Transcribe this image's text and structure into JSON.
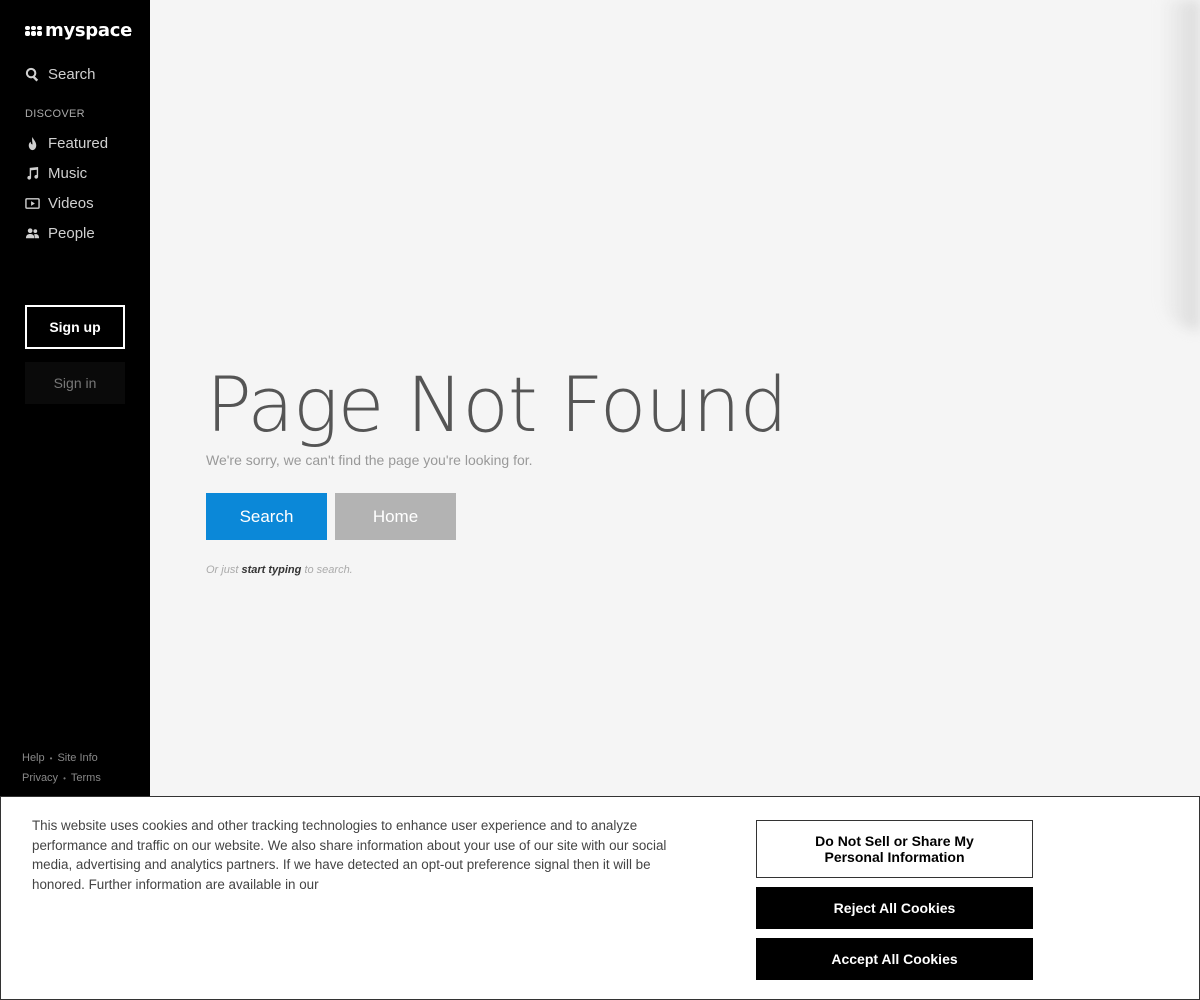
{
  "logo": {
    "text": "myspace"
  },
  "sidebar": {
    "search_label": "Search",
    "section_label": "DISCOVER",
    "items": [
      {
        "label": "Featured",
        "icon": "flame-icon"
      },
      {
        "label": "Music",
        "icon": "music-note-icon"
      },
      {
        "label": "Videos",
        "icon": "video-icon"
      },
      {
        "label": "People",
        "icon": "people-icon"
      }
    ],
    "signup_label": "Sign up",
    "signin_label": "Sign in",
    "footer": {
      "help": "Help",
      "site_info": "Site Info",
      "privacy": "Privacy",
      "terms": "Terms"
    }
  },
  "main": {
    "title": "Page Not Found",
    "subtitle": "We're sorry, we can't find the page you're looking for.",
    "search_button": "Search",
    "home_button": "Home",
    "hint_prefix": "Or just",
    "hint_bold": "start typing",
    "hint_suffix": "to search."
  },
  "cookie_banner": {
    "text": "This website uses cookies and other tracking technologies to enhance user experience and to analyze performance and traffic on our website. We also share information about your use of our site with our social media, advertising and analytics partners. If we have detected an opt-out preference signal then it will be honored. Further information are available in our",
    "do_not_sell_label": "Do Not Sell or Share My Personal Information",
    "reject_label": "Reject All Cookies",
    "accept_label": "Accept All Cookies"
  },
  "colors": {
    "sidebar_bg": "#000000",
    "page_bg": "#f5f5f5",
    "search_button": "#0b88d8",
    "home_button": "#b3b3b3"
  }
}
